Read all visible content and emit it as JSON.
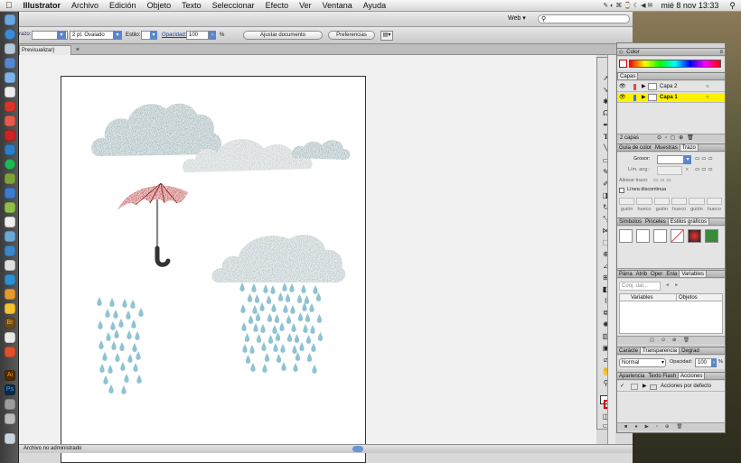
{
  "menubar": {
    "app_name": "Illustrator",
    "items": [
      "Archivo",
      "Edición",
      "Objeto",
      "Texto",
      "Seleccionar",
      "Efecto",
      "Ver",
      "Ventana",
      "Ayuda"
    ],
    "clock": "mié 8 nov  13:33"
  },
  "appbar": {
    "workspace": "Web",
    "search_placeholder": ""
  },
  "control_bar": {
    "stroke_label": "razo:",
    "stroke_value": "",
    "brush_value": "2 pt. Ovalado",
    "style_label": "Estilo:",
    "opacity_label": "Opacidad:",
    "opacity_value": "100",
    "opacity_unit": "%",
    "doc_setup_button": "Ajustar documento",
    "preferences_button": "Preferencias"
  },
  "document_tab": {
    "title": "Previsualizar)",
    "close": "×"
  },
  "status_bar": {
    "text": "Archivo no administrado"
  },
  "colors": {
    "cloud_blue": "#9fb6ba",
    "cloud_gray": "#c9cfcf",
    "umbrella_red": "#c62a2a",
    "raindrop": "#8fc3d1",
    "layer_highlight": "#fff200",
    "panel_bg": "#e4e4e4"
  },
  "panels": {
    "color": {
      "title": "Color"
    },
    "layers": {
      "title": "Capas",
      "layers": [
        {
          "name": "Capa 2",
          "color": "#e34a4a"
        },
        {
          "name": "Capa 1",
          "color": "#4a6cff"
        }
      ],
      "count": "2 capas"
    },
    "stroke_group": {
      "tabs": [
        "Guía de color",
        "Muestras",
        "Trazo"
      ],
      "weight_label": "Grosor:",
      "limit_label": "Lím. ang.:",
      "limit_mult": "x",
      "align_label": "Alinear trazo:",
      "dashed_label": "Línea discontinua",
      "dash_labels": [
        "guión",
        "hueco",
        "guión",
        "hueco",
        "guión",
        "hueco"
      ]
    },
    "graphic_styles_group": {
      "tabs": [
        "Símbolos",
        "Pinceles",
        "Estilos gráficos"
      ]
    },
    "variables_group": {
      "tabs": [
        "Párra",
        "Atrib",
        "Oper",
        "Enla",
        "Variables"
      ],
      "dataset_placeholder": "Conj. dat...",
      "col_variables": "Variables",
      "col_objects": "Objetos"
    },
    "transparency_group": {
      "tabs": [
        "Carácte",
        "Transparencia",
        "Degrad"
      ],
      "mode": "Normal",
      "opacity_label": "Opacidad:",
      "opacity_value": "100",
      "opacity_unit": "%"
    },
    "actions_group": {
      "tabs": [
        "Apariencia",
        "Texto Flash",
        "Acciones"
      ],
      "default_set": "Acciones por defecto"
    }
  }
}
